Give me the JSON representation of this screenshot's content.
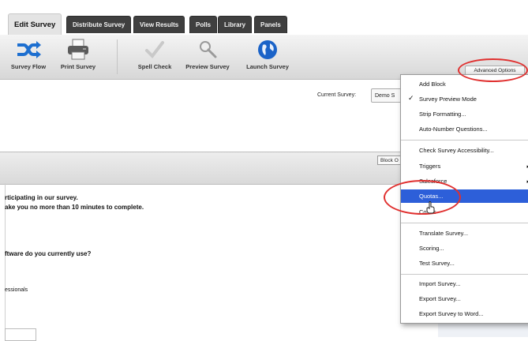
{
  "tabs": [
    {
      "label": "Edit Survey",
      "active": true
    },
    {
      "label": "Distribute Survey",
      "active": false
    },
    {
      "label": "View Results",
      "active": false
    },
    {
      "label": "Polls",
      "active": false
    },
    {
      "label": "Library",
      "active": false
    },
    {
      "label": "Panels",
      "active": false
    }
  ],
  "toolbar": {
    "survey_flow": {
      "label": "Survey Flow",
      "icon": "survey-flow-icon"
    },
    "print_survey": {
      "label": "Print Survey",
      "icon": "printer-icon"
    },
    "spell_check": {
      "label": "Spell Check",
      "icon": "spell-check-icon"
    },
    "preview_survey": {
      "label": "Preview Survey",
      "icon": "magnifier-icon"
    },
    "launch_survey": {
      "label": "Launch Survey",
      "icon": "globe-icon"
    },
    "advanced_options": "Advanced Options"
  },
  "content": {
    "current_survey_label": "Current Survey:",
    "current_survey_value": "Demo S",
    "block_button": "Block O",
    "intro_line1": "rticipating in our survey.",
    "intro_line2": "ake you no more than 10 minutes to complete.",
    "question_text": "ftware do you currently use?",
    "answer_text": "essionals"
  },
  "menu": {
    "group1": [
      {
        "label": "Add Block",
        "checked": false
      },
      {
        "label": "Survey Preview Mode",
        "checked": true
      },
      {
        "label": "Strip Formatting...",
        "checked": false
      },
      {
        "label": "Auto-Number Questions...",
        "checked": false
      }
    ],
    "group2": [
      {
        "label": "Check Survey Accessibility...",
        "submenu": false
      },
      {
        "label": "Triggers",
        "submenu": true
      },
      {
        "label": "Salesforce",
        "submenu": true
      },
      {
        "label": "Quotas...",
        "submenu": false,
        "highlighted": true
      },
      {
        "label": "Co nts",
        "submenu": false
      }
    ],
    "group3": [
      {
        "label": "Translate Survey..."
      },
      {
        "label": "Scoring..."
      },
      {
        "label": "Test Survey..."
      }
    ],
    "group4": [
      {
        "label": "Import Survey..."
      },
      {
        "label": "Export Survey..."
      },
      {
        "label": "Export Survey to Word..."
      }
    ]
  },
  "colors": {
    "highlight": "#2d5fd9",
    "annotation": "#e0302f",
    "tab_dark": "#3f3f3f"
  }
}
